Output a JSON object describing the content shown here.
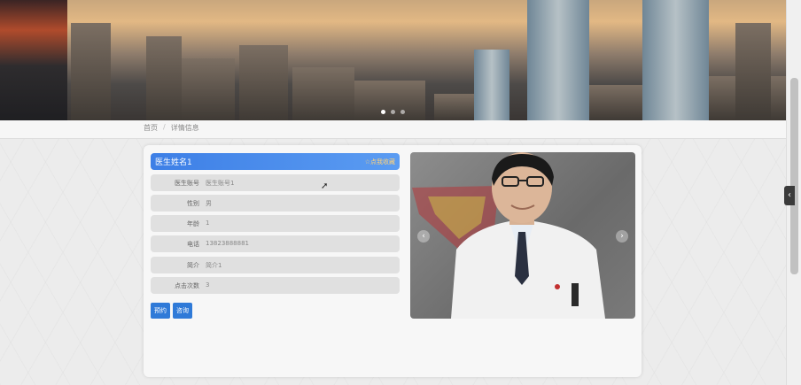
{
  "breadcrumb": {
    "home": "首页",
    "separator": "/",
    "current": "详情信息"
  },
  "doctor": {
    "name": "医生姓名1",
    "favorite": "☆点我收藏",
    "fields": [
      {
        "label": "医生账号",
        "value": "医生账号1"
      },
      {
        "label": "性别",
        "value": "男"
      },
      {
        "label": "年龄",
        "value": "1"
      },
      {
        "label": "电话",
        "value": "13823888881"
      },
      {
        "label": "简介",
        "value": "简介1"
      },
      {
        "label": "点击次数",
        "value": "3"
      }
    ]
  },
  "actions": {
    "book": "预约",
    "consult": "咨询"
  },
  "carousel": {
    "prev": "‹",
    "next": "›",
    "side_toggle": "‹"
  },
  "colors": {
    "accent": "#3d7fe6",
    "button": "#2f7ad8"
  },
  "icons": {
    "favorite": "star-icon",
    "prev": "chevron-left-icon",
    "next": "chevron-right-icon"
  }
}
